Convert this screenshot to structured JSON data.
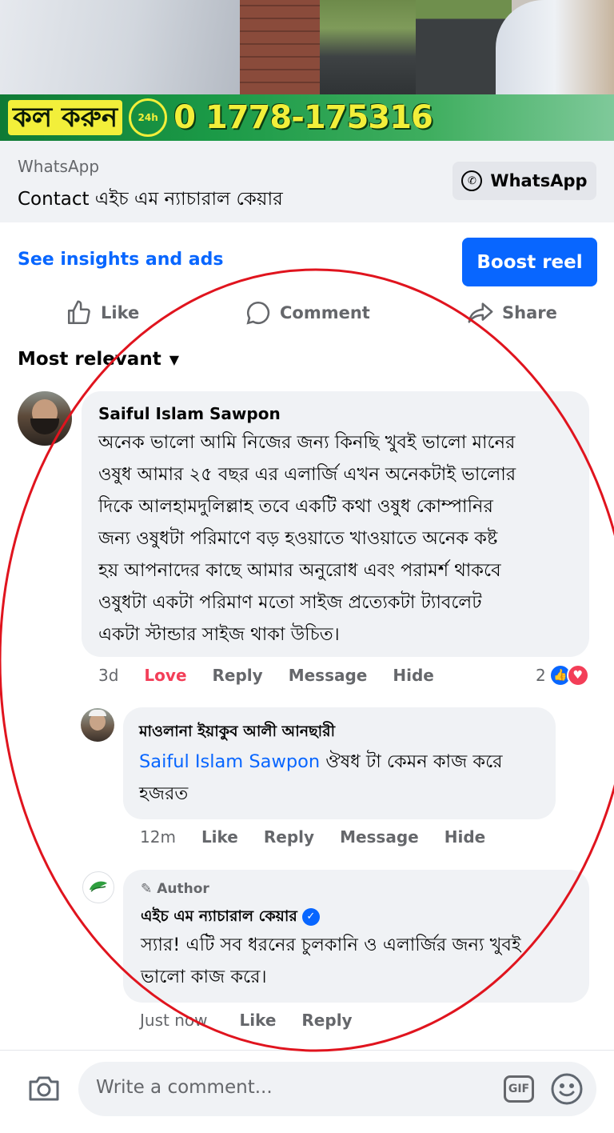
{
  "banner": {
    "call_text": "কল করুন",
    "phone_badge": "24h",
    "phone_number": "0 1778-175316"
  },
  "cta": {
    "subtitle": "WhatsApp",
    "title": "Contact এইচ এম ন্যাচারাল কেয়ার",
    "button_label": "WhatsApp"
  },
  "promo": {
    "insights_label": "See insights and ads",
    "boost_label": "Boost reel"
  },
  "actions": {
    "like": "Like",
    "comment": "Comment",
    "share": "Share"
  },
  "sort": {
    "label": "Most relevant"
  },
  "comments": [
    {
      "name": "Saiful Islam Sawpon",
      "lines": [
        "অনেক ভালো আমি নিজের জন্য কিনছি খুবই ভালো মানের",
        "ওষুধ আমার ২৫ বছর এর এলার্জি এখন অনেকটাই ভালোর",
        "দিকে আলহামদুলিল্লাহ তবে একটি কথা ওষুধ কোম্পানির",
        "জন্য ওষুধটা পরিমাণে বড় হওয়াতে খাওয়াতে অনেক কষ্ট",
        "হয় আপনাদের কাছে আমার অনুরোধ এবং পরামর্শ থাকবে",
        "ওষুধটা একটা পরিমাণ মতো সাইজ প্রত্যেকটা ট্যাবলেট",
        "একটা স্টান্ডার সাইজ থাকা উচিত।"
      ],
      "time": "3d",
      "reaction_label": "Love",
      "reply": "Reply",
      "message": "Message",
      "hide": "Hide",
      "reaction_count": "2"
    },
    {
      "name": "মাওলানা ইয়াকুব আলী আনছারী",
      "mention": "Saiful Islam Sawpon",
      "line1_rest": " ঔষধ টা কেমন কাজ করে",
      "line2": "হজরত",
      "time": "12m",
      "like": "Like",
      "reply": "Reply",
      "message": "Message",
      "hide": "Hide"
    },
    {
      "author_tag": "Author",
      "name": "এইচ এম ন্যাচারাল কেয়ার",
      "lines": [
        "স্যার! এটি সব ধরনের চুলকানি ও এলার্জির জন্য খুবই",
        "ভালো কাজ করে।"
      ],
      "time": "Just now",
      "like": "Like",
      "reply": "Reply"
    }
  ],
  "composer": {
    "placeholder": "Write a comment...",
    "gif_label": "GIF"
  },
  "colors": {
    "accent": "#0866ff",
    "love": "#f33e58",
    "annotation_circle": "#e0141e"
  }
}
